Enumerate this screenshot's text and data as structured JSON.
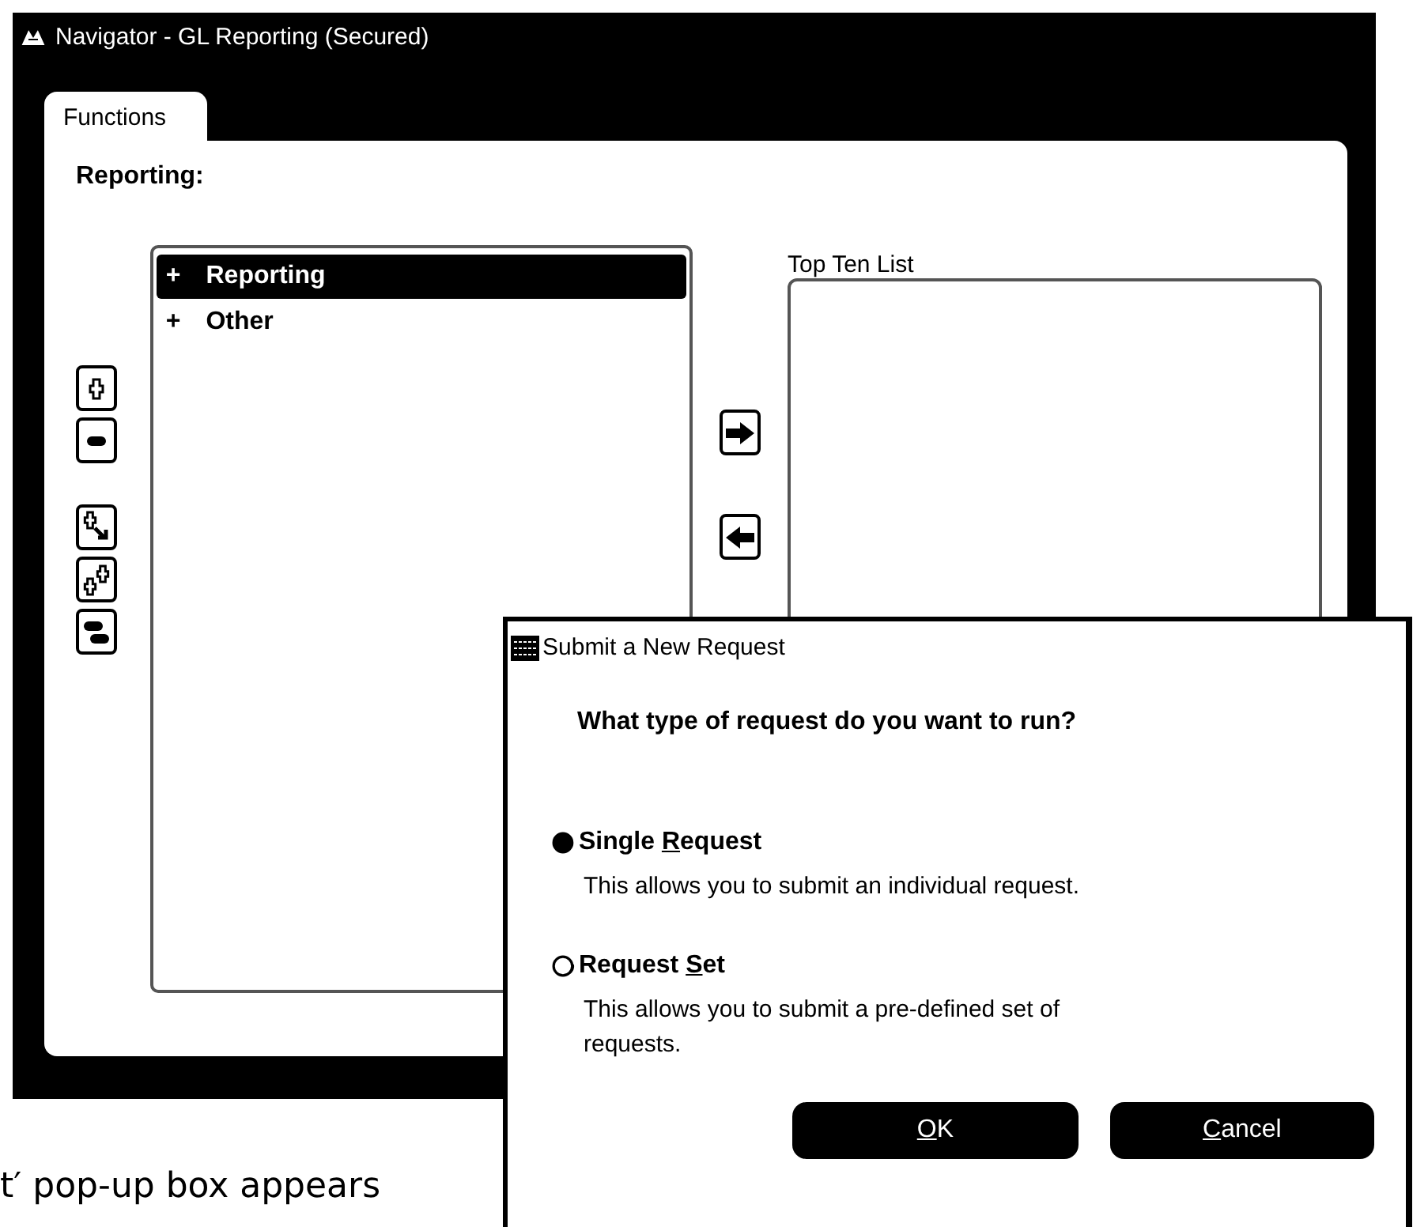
{
  "navigator": {
    "title": "Navigator - GL Reporting (Secured)",
    "tabs": [
      {
        "label": "Functions",
        "selected": true
      }
    ],
    "heading": "Reporting:",
    "tools": [
      {
        "kind": "expand"
      },
      {
        "kind": "collapse"
      },
      {
        "kind": "expand-branch"
      },
      {
        "kind": "expand-all"
      },
      {
        "kind": "collapse-all"
      }
    ],
    "items": [
      {
        "marker": "+",
        "label": "Reporting",
        "selected": true
      },
      {
        "marker": "+",
        "label": "Other",
        "selected": false
      }
    ],
    "transfer": [
      {
        "kind": "add"
      },
      {
        "kind": "remove"
      }
    ],
    "top_ten": {
      "label": "Top Ten List"
    }
  },
  "dialog": {
    "title": "Submit a New Request",
    "question": "What type of request do you want to run?",
    "options": [
      {
        "label": {
          "before": "Single ",
          "key": "R",
          "after": "equest"
        },
        "description": "This allows you to submit an individual request.",
        "selected": true
      },
      {
        "label": {
          "before": "Request ",
          "key": "S",
          "after": "et"
        },
        "description": "This allows you to submit a pre-defined set of requests.",
        "selected": false
      }
    ],
    "buttons": [
      {
        "label": {
          "key": "O",
          "after": "K"
        }
      },
      {
        "label": {
          "key": "C",
          "after": "ancel"
        }
      }
    ]
  },
  "caption": "t′ pop-up box appears"
}
